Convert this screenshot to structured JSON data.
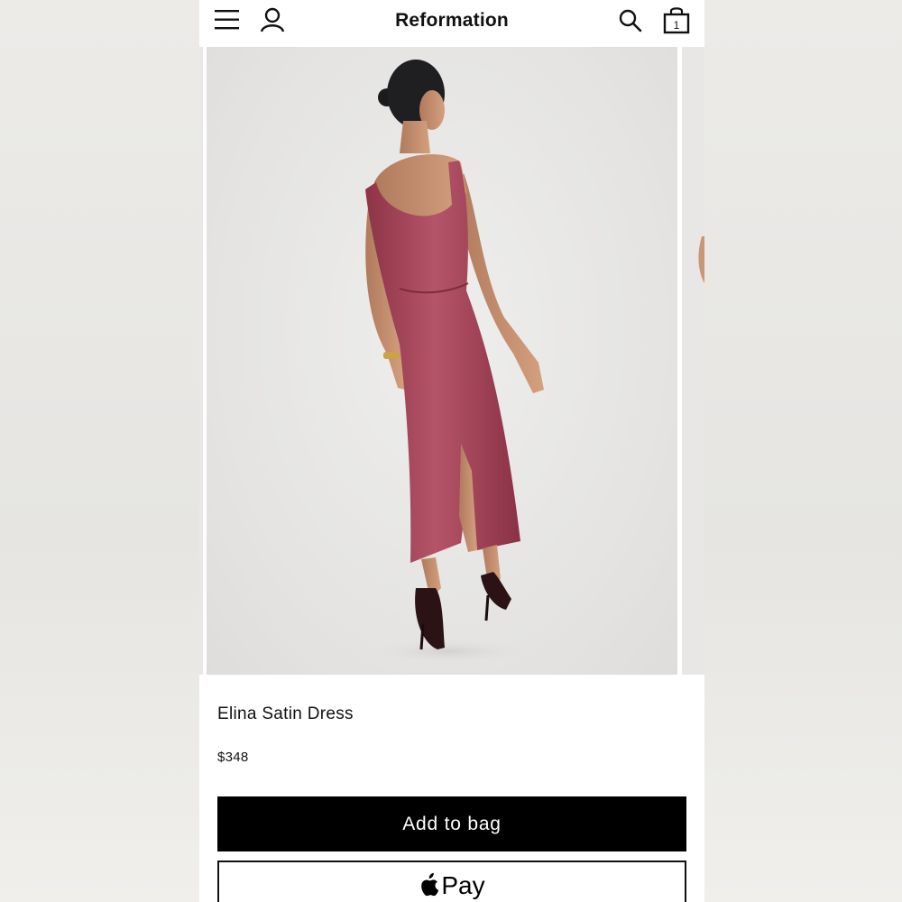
{
  "header": {
    "brand": "Reformation",
    "bag_count": "1",
    "icons": {
      "menu": "menu-icon",
      "account": "account-icon",
      "search": "search-icon",
      "bag": "shopping-bag-icon"
    }
  },
  "product": {
    "name": "Elina Satin Dress",
    "price": "$348",
    "dress_color": "#a8475a"
  },
  "actions": {
    "add_to_bag_label": "Add to bag",
    "apple_pay_label": "Pay"
  },
  "colors": {
    "primary_button": "#000000",
    "background": "#ffffff"
  }
}
